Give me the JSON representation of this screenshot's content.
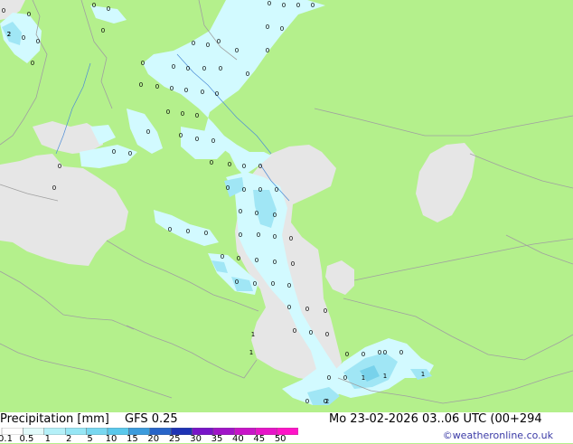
{
  "title": "Precipitation [mm]",
  "model": "GFS 0.25",
  "valid_time": "Mo 23-02-2026 03..06 UTC (00+294",
  "credit": "©weatheronline.co.uk",
  "legend": {
    "labels": [
      "0.1",
      "0.5",
      "1",
      "2",
      "5",
      "10",
      "15",
      "20",
      "25",
      "30",
      "35",
      "40",
      "45",
      "50"
    ],
    "colors": [
      "#ffffff",
      "#e1fafa",
      "#b4f0f8",
      "#96e6f5",
      "#78d7f0",
      "#5ac8eb",
      "#3c9bdc",
      "#2864c8",
      "#1e32b4",
      "#7814c8",
      "#a014c8",
      "#c814c8",
      "#e614c8",
      "#ff14c8"
    ]
  },
  "map": {
    "land_color": "#b4f08c",
    "sea_color": "#e6e6e6",
    "rain_light_color": "#d2faff",
    "rain_mid_color": "#a0e6f5",
    "rain_heavy_color": "#78d2eb",
    "values": [
      "2",
      "0",
      "0",
      "0",
      "0",
      "0",
      "0",
      "0",
      "0",
      "0",
      "0",
      "0",
      "0",
      "0",
      "0",
      "0",
      "0",
      "0",
      "0",
      "0",
      "0",
      "0",
      "0",
      "0",
      "0",
      "0",
      "0",
      "0",
      "0",
      "0",
      "0",
      "0",
      "0",
      "0",
      "0",
      "0",
      "0",
      "0",
      "0",
      "0",
      "0",
      "0",
      "0",
      "0",
      "0",
      "0",
      "0",
      "0",
      "0",
      "0",
      "0",
      "0",
      "0",
      "0",
      "0",
      "0",
      "0",
      "0",
      "0",
      "0",
      "0",
      "0",
      "0",
      "0",
      "0",
      "0",
      "0",
      "0",
      "0",
      "0",
      "0",
      "0",
      "0",
      "0",
      "0",
      "0",
      "1",
      "0",
      "0",
      "0",
      "0",
      "0",
      "0",
      "0",
      "1",
      "1",
      "1",
      "2",
      "0",
      "1",
      "0",
      "2"
    ]
  }
}
